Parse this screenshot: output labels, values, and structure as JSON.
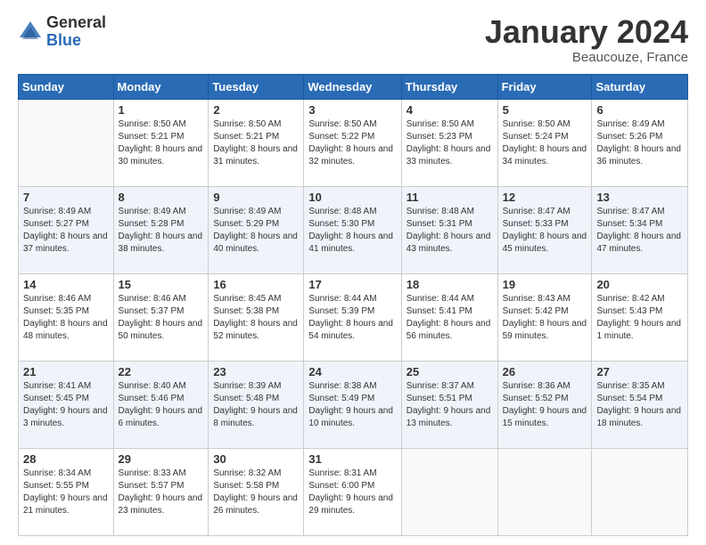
{
  "header": {
    "logo_general": "General",
    "logo_blue": "Blue",
    "month_title": "January 2024",
    "location": "Beaucouze, France"
  },
  "weekdays": [
    "Sunday",
    "Monday",
    "Tuesday",
    "Wednesday",
    "Thursday",
    "Friday",
    "Saturday"
  ],
  "weeks": [
    [
      {
        "day": "",
        "sunrise": "",
        "sunset": "",
        "daylight": ""
      },
      {
        "day": "1",
        "sunrise": "Sunrise: 8:50 AM",
        "sunset": "Sunset: 5:21 PM",
        "daylight": "Daylight: 8 hours and 30 minutes."
      },
      {
        "day": "2",
        "sunrise": "Sunrise: 8:50 AM",
        "sunset": "Sunset: 5:21 PM",
        "daylight": "Daylight: 8 hours and 31 minutes."
      },
      {
        "day": "3",
        "sunrise": "Sunrise: 8:50 AM",
        "sunset": "Sunset: 5:22 PM",
        "daylight": "Daylight: 8 hours and 32 minutes."
      },
      {
        "day": "4",
        "sunrise": "Sunrise: 8:50 AM",
        "sunset": "Sunset: 5:23 PM",
        "daylight": "Daylight: 8 hours and 33 minutes."
      },
      {
        "day": "5",
        "sunrise": "Sunrise: 8:50 AM",
        "sunset": "Sunset: 5:24 PM",
        "daylight": "Daylight: 8 hours and 34 minutes."
      },
      {
        "day": "6",
        "sunrise": "Sunrise: 8:49 AM",
        "sunset": "Sunset: 5:26 PM",
        "daylight": "Daylight: 8 hours and 36 minutes."
      }
    ],
    [
      {
        "day": "7",
        "sunrise": "Sunrise: 8:49 AM",
        "sunset": "Sunset: 5:27 PM",
        "daylight": "Daylight: 8 hours and 37 minutes."
      },
      {
        "day": "8",
        "sunrise": "Sunrise: 8:49 AM",
        "sunset": "Sunset: 5:28 PM",
        "daylight": "Daylight: 8 hours and 38 minutes."
      },
      {
        "day": "9",
        "sunrise": "Sunrise: 8:49 AM",
        "sunset": "Sunset: 5:29 PM",
        "daylight": "Daylight: 8 hours and 40 minutes."
      },
      {
        "day": "10",
        "sunrise": "Sunrise: 8:48 AM",
        "sunset": "Sunset: 5:30 PM",
        "daylight": "Daylight: 8 hours and 41 minutes."
      },
      {
        "day": "11",
        "sunrise": "Sunrise: 8:48 AM",
        "sunset": "Sunset: 5:31 PM",
        "daylight": "Daylight: 8 hours and 43 minutes."
      },
      {
        "day": "12",
        "sunrise": "Sunrise: 8:47 AM",
        "sunset": "Sunset: 5:33 PM",
        "daylight": "Daylight: 8 hours and 45 minutes."
      },
      {
        "day": "13",
        "sunrise": "Sunrise: 8:47 AM",
        "sunset": "Sunset: 5:34 PM",
        "daylight": "Daylight: 8 hours and 47 minutes."
      }
    ],
    [
      {
        "day": "14",
        "sunrise": "Sunrise: 8:46 AM",
        "sunset": "Sunset: 5:35 PM",
        "daylight": "Daylight: 8 hours and 48 minutes."
      },
      {
        "day": "15",
        "sunrise": "Sunrise: 8:46 AM",
        "sunset": "Sunset: 5:37 PM",
        "daylight": "Daylight: 8 hours and 50 minutes."
      },
      {
        "day": "16",
        "sunrise": "Sunrise: 8:45 AM",
        "sunset": "Sunset: 5:38 PM",
        "daylight": "Daylight: 8 hours and 52 minutes."
      },
      {
        "day": "17",
        "sunrise": "Sunrise: 8:44 AM",
        "sunset": "Sunset: 5:39 PM",
        "daylight": "Daylight: 8 hours and 54 minutes."
      },
      {
        "day": "18",
        "sunrise": "Sunrise: 8:44 AM",
        "sunset": "Sunset: 5:41 PM",
        "daylight": "Daylight: 8 hours and 56 minutes."
      },
      {
        "day": "19",
        "sunrise": "Sunrise: 8:43 AM",
        "sunset": "Sunset: 5:42 PM",
        "daylight": "Daylight: 8 hours and 59 minutes."
      },
      {
        "day": "20",
        "sunrise": "Sunrise: 8:42 AM",
        "sunset": "Sunset: 5:43 PM",
        "daylight": "Daylight: 9 hours and 1 minute."
      }
    ],
    [
      {
        "day": "21",
        "sunrise": "Sunrise: 8:41 AM",
        "sunset": "Sunset: 5:45 PM",
        "daylight": "Daylight: 9 hours and 3 minutes."
      },
      {
        "day": "22",
        "sunrise": "Sunrise: 8:40 AM",
        "sunset": "Sunset: 5:46 PM",
        "daylight": "Daylight: 9 hours and 6 minutes."
      },
      {
        "day": "23",
        "sunrise": "Sunrise: 8:39 AM",
        "sunset": "Sunset: 5:48 PM",
        "daylight": "Daylight: 9 hours and 8 minutes."
      },
      {
        "day": "24",
        "sunrise": "Sunrise: 8:38 AM",
        "sunset": "Sunset: 5:49 PM",
        "daylight": "Daylight: 9 hours and 10 minutes."
      },
      {
        "day": "25",
        "sunrise": "Sunrise: 8:37 AM",
        "sunset": "Sunset: 5:51 PM",
        "daylight": "Daylight: 9 hours and 13 minutes."
      },
      {
        "day": "26",
        "sunrise": "Sunrise: 8:36 AM",
        "sunset": "Sunset: 5:52 PM",
        "daylight": "Daylight: 9 hours and 15 minutes."
      },
      {
        "day": "27",
        "sunrise": "Sunrise: 8:35 AM",
        "sunset": "Sunset: 5:54 PM",
        "daylight": "Daylight: 9 hours and 18 minutes."
      }
    ],
    [
      {
        "day": "28",
        "sunrise": "Sunrise: 8:34 AM",
        "sunset": "Sunset: 5:55 PM",
        "daylight": "Daylight: 9 hours and 21 minutes."
      },
      {
        "day": "29",
        "sunrise": "Sunrise: 8:33 AM",
        "sunset": "Sunset: 5:57 PM",
        "daylight": "Daylight: 9 hours and 23 minutes."
      },
      {
        "day": "30",
        "sunrise": "Sunrise: 8:32 AM",
        "sunset": "Sunset: 5:58 PM",
        "daylight": "Daylight: 9 hours and 26 minutes."
      },
      {
        "day": "31",
        "sunrise": "Sunrise: 8:31 AM",
        "sunset": "Sunset: 6:00 PM",
        "daylight": "Daylight: 9 hours and 29 minutes."
      },
      {
        "day": "",
        "sunrise": "",
        "sunset": "",
        "daylight": ""
      },
      {
        "day": "",
        "sunrise": "",
        "sunset": "",
        "daylight": ""
      },
      {
        "day": "",
        "sunrise": "",
        "sunset": "",
        "daylight": ""
      }
    ]
  ]
}
